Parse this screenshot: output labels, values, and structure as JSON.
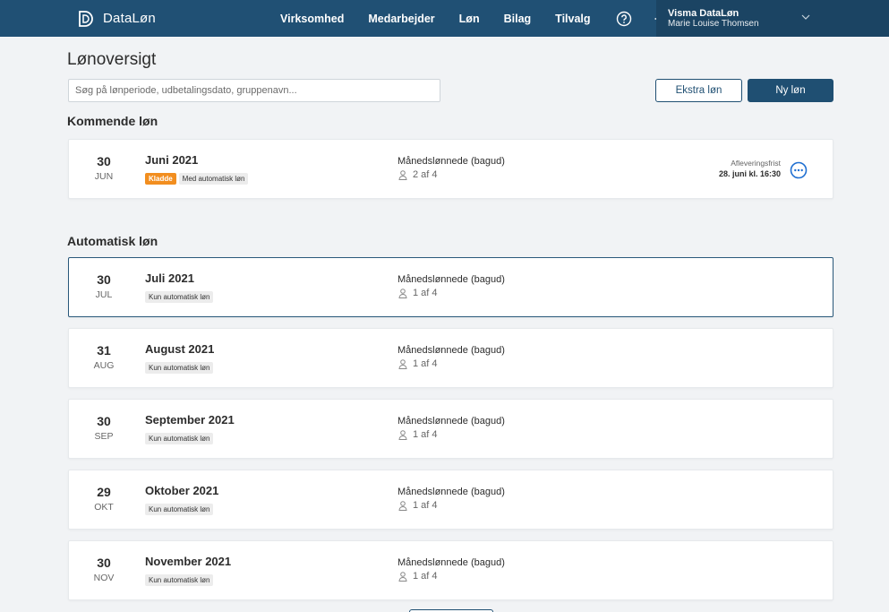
{
  "header": {
    "brand": "DataLøn",
    "nav": [
      "Virksomhed",
      "Medarbejder",
      "Løn",
      "Bilag",
      "Tilvalg"
    ],
    "icons": [
      "help-icon",
      "settings-icon"
    ],
    "account": {
      "company": "Visma DataLøn",
      "user": "Marie Louise Thomsen"
    }
  },
  "page": {
    "title": "Lønoversigt",
    "search_placeholder": "Søg på lønperiode, udbetalingsdato, gruppenavn...",
    "extra_button": "Ekstra løn",
    "new_button": "Ny løn"
  },
  "upcoming": {
    "title": "Kommende løn",
    "items": [
      {
        "day": "30",
        "month": "JUN",
        "period": "Juni 2021",
        "tags": [
          "Kladde",
          "Med automatisk løn"
        ],
        "group": "Månedslønnede (bagud)",
        "employees": "2 af 4",
        "deadline_label": "Afleveringsfrist",
        "deadline": "28. juni kl. 16:30"
      }
    ]
  },
  "automatic": {
    "title": "Automatisk løn",
    "items": [
      {
        "day": "30",
        "month": "JUL",
        "period": "Juli 2021",
        "tag": "Kun automatisk løn",
        "group": "Månedslønnede (bagud)",
        "employees": "1 af 4"
      },
      {
        "day": "31",
        "month": "AUG",
        "period": "August 2021",
        "tag": "Kun automatisk løn",
        "group": "Månedslønnede (bagud)",
        "employees": "1 af 4"
      },
      {
        "day": "30",
        "month": "SEP",
        "period": "September 2021",
        "tag": "Kun automatisk løn",
        "group": "Månedslønnede (bagud)",
        "employees": "1 af 4"
      },
      {
        "day": "29",
        "month": "OKT",
        "period": "Oktober 2021",
        "tag": "Kun automatisk løn",
        "group": "Månedslønnede (bagud)",
        "employees": "1 af 4"
      },
      {
        "day": "30",
        "month": "NOV",
        "period": "November 2021",
        "tag": "Kun automatisk løn",
        "group": "Månedslønnede (bagud)",
        "employees": "1 af 4"
      }
    ]
  },
  "colors": {
    "header": "#205074",
    "accent": "#1f4f72",
    "draft_tag": "#f28e1f"
  }
}
